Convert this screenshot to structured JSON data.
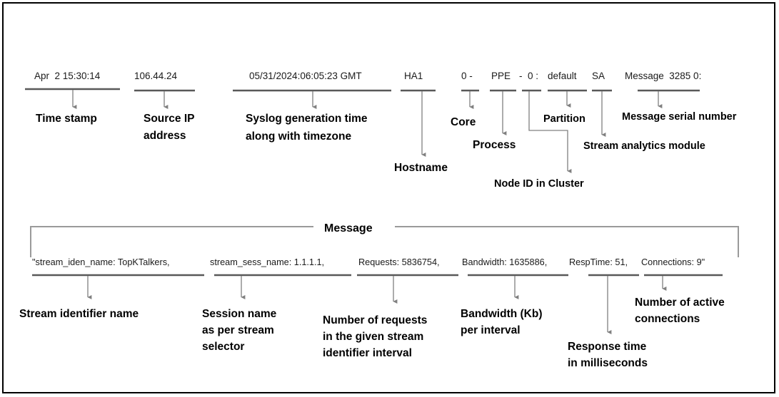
{
  "figure": {
    "title": "Syslog message format breakdown",
    "border_color": "#000000",
    "background": "#ffffff",
    "underline_color": "#595959",
    "leader_color": "#808080",
    "bracket_color": "#9a9a9a"
  },
  "header_line": {
    "tokens": [
      {
        "id": "timestamp",
        "text": "Apr  2 15:30:14",
        "label": "Time stamp"
      },
      {
        "id": "source_ip",
        "text": "106.44.24",
        "label": "Source IP\naddress"
      },
      {
        "id": "syslog_time",
        "text": "05/31/2024:06:05:23 GMT",
        "label": "Syslog generation time\nalong with timezone"
      },
      {
        "id": "hostname",
        "text": "HA1",
        "label": "Hostname"
      },
      {
        "id": "core",
        "text": "0 -",
        "label": "Core"
      },
      {
        "id": "process",
        "text": "PPE",
        "label": "Process"
      },
      {
        "id": "node_id",
        "text": "- 0 :",
        "label": "Node ID in Cluster"
      },
      {
        "id": "partition",
        "text": "default",
        "label": "Partition"
      },
      {
        "id": "sa_module",
        "text": "SA",
        "label": "Stream analytics module"
      },
      {
        "id": "serial",
        "text": "Message  3285 0:",
        "label": "Message serial number"
      }
    ]
  },
  "message_section": {
    "bracket_label": "Message",
    "payload_text": "\"stream_iden_name: TopKTalkers, stream_sess_name: 1.1.1.1, Requests: 5836754, Bandwidth: 1635886, RespTime: 51, Connections: 9\"",
    "fields": [
      {
        "id": "stream_iden_name",
        "text": "\"stream_iden_name: TopKTalkers,",
        "label": "Stream identifier name"
      },
      {
        "id": "stream_sess_name",
        "text": "stream_sess_name: 1.1.1.1,",
        "label": "Session name\nas per stream\nselector"
      },
      {
        "id": "requests",
        "text": "Requests: 5836754,",
        "label": "Number of requests\nin the given stream\nidentifier interval"
      },
      {
        "id": "bandwidth",
        "text": "Bandwidth: 1635886,",
        "label": "Bandwidth (Kb)\nper interval"
      },
      {
        "id": "resptime",
        "text": "RespTime: 51,",
        "label": "Response time\nin milliseconds"
      },
      {
        "id": "connections",
        "text": "Connections: 9\"",
        "label": "Number of active\nconnections"
      }
    ]
  },
  "header_text_parts": {
    "timestamp": "Apr  2 15:30:14",
    "source_ip": "106.44.24",
    "syslog_time": "05/31/2024:06:05:23 GMT",
    "hostname": "HA1",
    "core": "0 -",
    "process": "PPE",
    "dash": "-",
    "node": "0 :",
    "partition": "default",
    "sa": "SA",
    "serial": "Message  3285 0:"
  },
  "header_labels": {
    "timestamp": "Time stamp",
    "source_ip_l1": "Source IP",
    "source_ip_l2": "address",
    "syslog_l1": "Syslog generation time",
    "syslog_l2": "along with timezone",
    "hostname": "Hostname",
    "core": "Core",
    "process": "Process",
    "node_id": "Node ID in Cluster",
    "partition": "Partition",
    "sa_module": "Stream analytics module",
    "serial": "Message serial number"
  },
  "message_labels": {
    "stream_iden": "Stream identifier name",
    "session_l1": "Session name",
    "session_l2": "as per stream",
    "session_l3": "selector",
    "requests_l1": "Number of requests",
    "requests_l2": "in the given stream",
    "requests_l3": "identifier interval",
    "bandwidth_l1": "Bandwidth (Kb)",
    "bandwidth_l2": "per interval",
    "resptime_l1": "Response time",
    "resptime_l2": "in milliseconds",
    "connections_l1": "Number of active",
    "connections_l2": "connections"
  },
  "message_text_parts": {
    "p1": "\"stream_iden_name: TopKTalkers,",
    "p2": "stream_sess_name: 1.1.1.1,",
    "p3": "Requests: 5836754,",
    "p4": "Bandwidth: 1635886,",
    "p5": "RespTime: 51,",
    "p6": "Connections: 9\""
  },
  "bracket": {
    "label": "Message"
  }
}
